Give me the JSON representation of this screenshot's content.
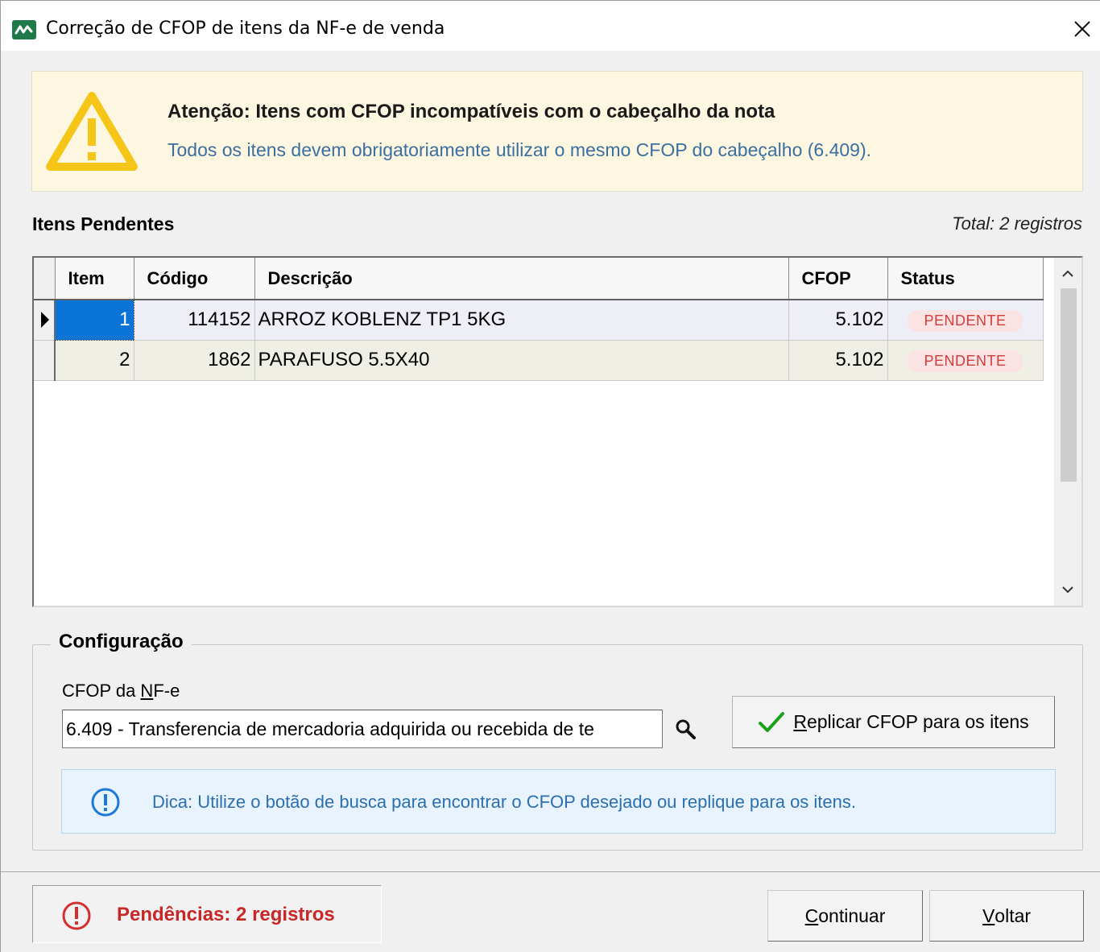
{
  "window": {
    "title": "Correção de CFOP de itens da NF-e de venda",
    "close_glyph": "✕"
  },
  "warning": {
    "icon": "warning-triangle-icon",
    "title": "Atenção: Itens com CFOP incompatíveis com o cabeçalho da nota",
    "text": "Todos os itens devem obrigatoriamente utilizar o mesmo CFOP do cabeçalho (6.409)."
  },
  "pending": {
    "title": "Itens Pendentes",
    "total": "Total: 2 registros",
    "columns": [
      "Item",
      "Código",
      "Descrição",
      "CFOP",
      "Status"
    ],
    "rows": [
      {
        "item": "1",
        "codigo": "114152",
        "descricao": "ARROZ KOBLENZ TP1 5KG",
        "cfop": "5.102",
        "status": "PENDENTE"
      },
      {
        "item": "2",
        "codigo": "1862",
        "descricao": "PARAFUSO 5.5X40",
        "cfop": "5.102",
        "status": "PENDENTE"
      }
    ]
  },
  "config": {
    "legend": "Configuração",
    "field_label_pre": "CFOP da ",
    "field_label_accel": "N",
    "field_label_post": "F-e",
    "cfop_value": "6.409 - Transferencia de mercadoria adquirida ou recebida de te",
    "replicate_accel": "R",
    "replicate_rest": "eplicar CFOP para os itens",
    "tip": "Dica: Utilize o botão de busca para encontrar o CFOP desejado ou replique para os itens."
  },
  "footer": {
    "pendencias": "Pendências: 2 registros",
    "continue_accel": "C",
    "continue_rest": "ontinuar",
    "back_accel": "V",
    "back_rest": "oltar"
  },
  "colors": {
    "warning_bg": "#fdf6e0",
    "warning_icon": "#f5c518",
    "selection": "#0a74d6",
    "status_pill_bg": "#fbe3e3",
    "status_pill_text": "#d43c3c",
    "tip_bg": "#e8f3fd",
    "tip_text": "#2c6fb0",
    "error_text": "#c62828",
    "check_green": "#1aa01a"
  }
}
